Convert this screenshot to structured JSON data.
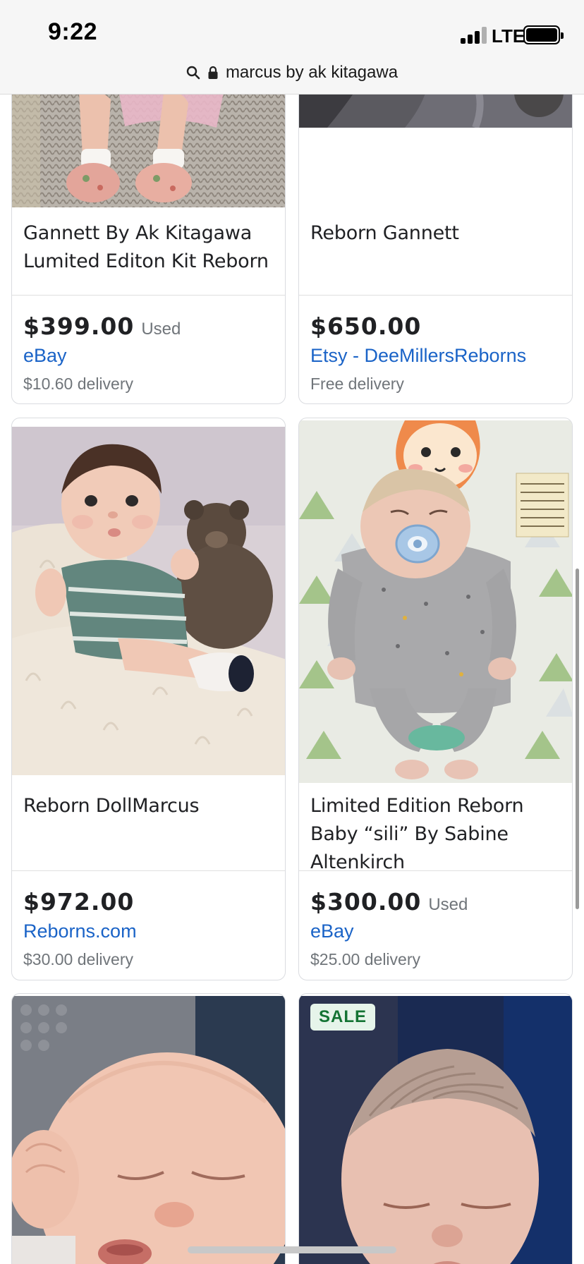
{
  "status_bar": {
    "time": "9:22",
    "network": "LTE"
  },
  "url_bar": {
    "text": "marcus by ak kitagawa"
  },
  "products": [
    {
      "title": "Gannett By Ak Kitagawa Lumited Editon Kit Reborn",
      "price": "$399.00",
      "condition": "Used",
      "seller": "eBay",
      "delivery": "$10.60 delivery"
    },
    {
      "title": "Reborn Gannett",
      "price": "$650.00",
      "condition": "",
      "seller": "Etsy - DeeMillersReborns",
      "delivery": "Free delivery"
    },
    {
      "title": "Reborn DollMarcus",
      "price": "$972.00",
      "condition": "",
      "seller": "Reborns.com",
      "delivery": "$30.00 delivery"
    },
    {
      "title": "Limited Edition Reborn Baby “sili” By Sabine Altenkirch",
      "price": "$300.00",
      "condition": "Used",
      "seller": "eBay",
      "delivery": "$25.00 delivery"
    },
    {
      "badge": "SALE"
    }
  ],
  "colors": {
    "seller_link": "#1a63c7",
    "sale_badge_bg": "#e6f4ea",
    "sale_badge_text": "#137333"
  }
}
